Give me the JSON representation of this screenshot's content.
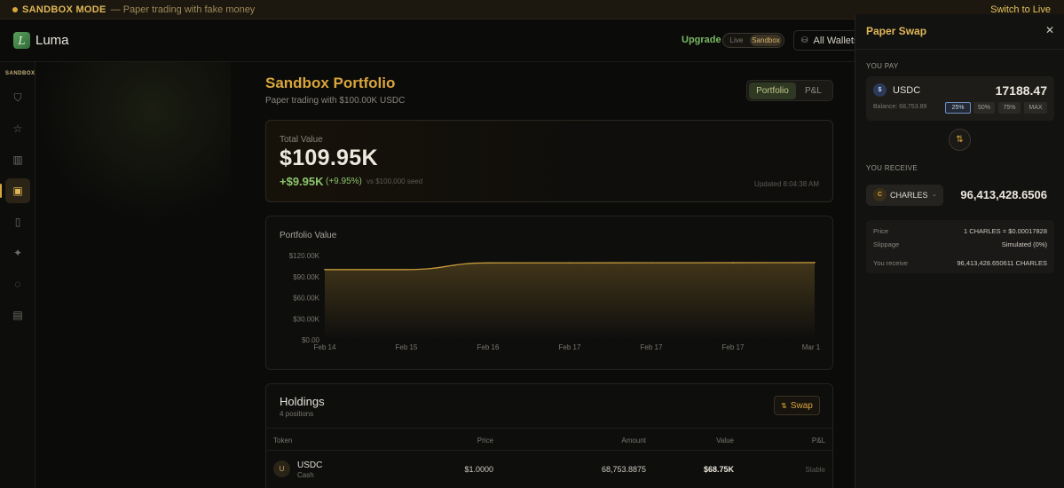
{
  "banner": {
    "mode": "SANDBOX MODE",
    "description": "— Paper trading with fake money",
    "switch": "Switch to Live"
  },
  "app": {
    "name": "Luma",
    "logo_letter": "L"
  },
  "header": {
    "upgrade": "Upgrade",
    "toggle": {
      "live": "Live",
      "sandbox": "Sandbox"
    },
    "wallets": "All Wallets"
  },
  "sidebar": {
    "tag": "SANDBOX",
    "items": [
      {
        "icon": "shield-icon",
        "glyph": "⛉"
      },
      {
        "icon": "star-icon",
        "glyph": "☆"
      },
      {
        "icon": "bar-chart-icon",
        "glyph": "▥"
      },
      {
        "icon": "wallet-icon",
        "glyph": "▣",
        "active": true
      },
      {
        "icon": "book-icon",
        "glyph": "▯"
      },
      {
        "icon": "sparkle-icon",
        "glyph": "✦"
      },
      {
        "icon": "lightbulb-icon",
        "glyph": "◌"
      },
      {
        "icon": "document-icon",
        "glyph": "▤"
      }
    ]
  },
  "page": {
    "title": "Sandbox Portfolio",
    "subtitle": "Paper trading with $100.00K USDC",
    "tabs": [
      "Portfolio",
      "P&L"
    ]
  },
  "total": {
    "label": "Total Value",
    "value": "$109.95K",
    "gain": "+$9.95K",
    "gain_pct": "(+9.95%)",
    "vs": "vs $100,000 seed",
    "updated": "Updated 8:04:38 AM"
  },
  "chart_data": {
    "type": "area",
    "title": "Portfolio Value",
    "xlabel": "",
    "ylabel": "",
    "x": [
      "Feb 14",
      "Feb 15",
      "Feb 16",
      "Feb 17",
      "Feb 17",
      "Feb 17",
      "Mar 1"
    ],
    "y_ticks": [
      "$120.00K",
      "$90.00K",
      "$60.00K",
      "$30.00K",
      "$0.00"
    ],
    "ylim": [
      0,
      120000
    ],
    "series": [
      {
        "values": [
          100000,
          100000,
          109500,
          109600,
          109700,
          109800,
          109950
        ]
      }
    ],
    "color": "#c49a3a",
    "grid": false
  },
  "holdings": {
    "title": "Holdings",
    "subtitle": "4 positions",
    "swap": "Swap",
    "columns": [
      "Token",
      "Price",
      "Amount",
      "Value",
      "P&L"
    ],
    "rows": [
      {
        "avatar": "U",
        "token": "USDC",
        "type": "Cash",
        "price": "$1.0000",
        "amount": "68,753.8875",
        "value": "$68.75K",
        "pnl": "Stable"
      }
    ]
  },
  "swap_panel": {
    "title": "Paper Swap",
    "pay_label": "YOU PAY",
    "pay_token": "USDC",
    "pay_coin": "$",
    "pay_amount": "17188.47",
    "balance": "Balance: 68,753.89",
    "presets": [
      "25%",
      "50%",
      "75%",
      "MAX"
    ],
    "receive_label": "YOU RECEIVE",
    "receive_token": "CHARLES",
    "receive_coin": "C",
    "receive_amount": "96,413,428.6506",
    "info": [
      {
        "label": "Price",
        "value": "1 CHARLES = $0.00017828"
      },
      {
        "label": "Slippage",
        "value": "Simulated (0%)"
      },
      {
        "label": "You receive",
        "value": "96,413,428.650611 CHARLES"
      }
    ]
  }
}
